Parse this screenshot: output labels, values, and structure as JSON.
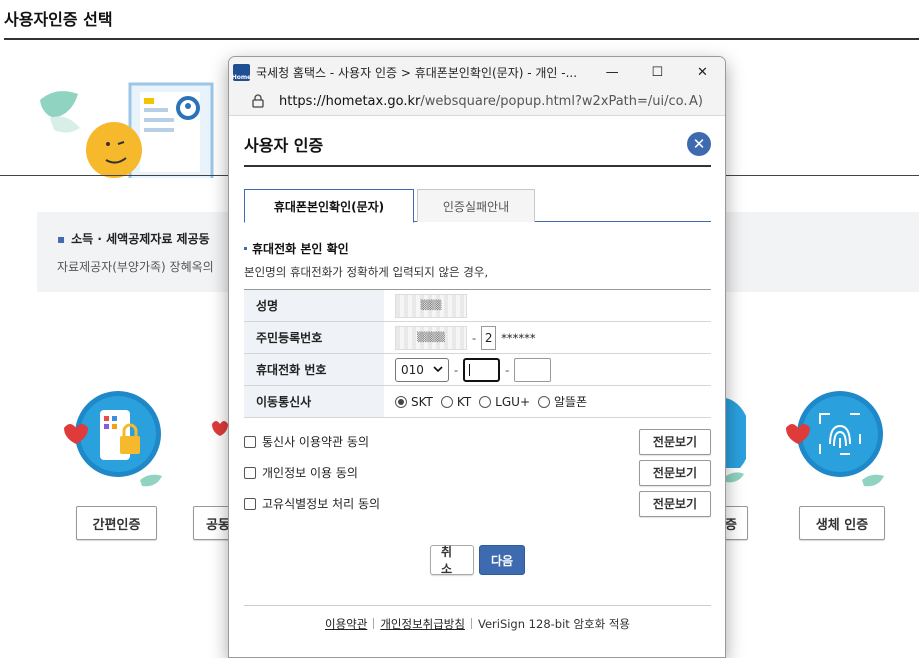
{
  "background": {
    "title": "사용자인증 선택",
    "notice_title": "소득 · 세액공제자료 제공동",
    "notice_text": "자료제공자(부양가족) 장혜옥의",
    "buttons": [
      "간편인증",
      "공동",
      "증",
      "생체 인증"
    ]
  },
  "window": {
    "title": "국세청 홈택스 - 사용자 인증 > 휴대폰본인확인(문자) - 개인 -...",
    "favicon_label": "Home",
    "minimize": "—",
    "maximize": "☐",
    "close": "✕",
    "url_host": "https://hometax.go.kr",
    "url_path": "/websquare/popup.html?w2xPath=/ui/co...",
    "read_mode": "A)"
  },
  "dialog": {
    "title": "사용자 인증",
    "close_symbol": "✕",
    "tabs": [
      "휴대폰본인확인(문자)",
      "인증실패안내"
    ],
    "section_title": "휴대전화 본인 확인",
    "section_desc": "본인명의 휴대전화가 정확하게 입력되지 않은 경우,",
    "form": {
      "name_label": "성명",
      "name_value": "▒▒▒",
      "rrn_label": "주민등록번호",
      "rrn_front": "▒▒▒▒",
      "rrn_back_first": "2",
      "rrn_mask": "******",
      "phone_label": "휴대전화 번호",
      "phone_prefix": "010",
      "carrier_label": "이동통신사",
      "carriers": [
        "SKT",
        "KT",
        "LGU+",
        "알뜰폰"
      ],
      "selected_carrier": "SKT"
    },
    "agreements": [
      {
        "label": "통신사 이용약관 동의",
        "button": "전문보기"
      },
      {
        "label": "개인정보 이용 동의",
        "button": "전문보기"
      },
      {
        "label": "고유식별정보 처리 동의",
        "button": "전문보기"
      }
    ],
    "cancel_label": "취소",
    "next_label": "다음",
    "footer": {
      "terms": "이용약관",
      "privacy": "개인정보취급방침",
      "security": "VeriSign 128-bit 암호화 적용"
    }
  },
  "colors": {
    "accent": "#3e6bb0",
    "label_bg": "#eff2f7"
  }
}
